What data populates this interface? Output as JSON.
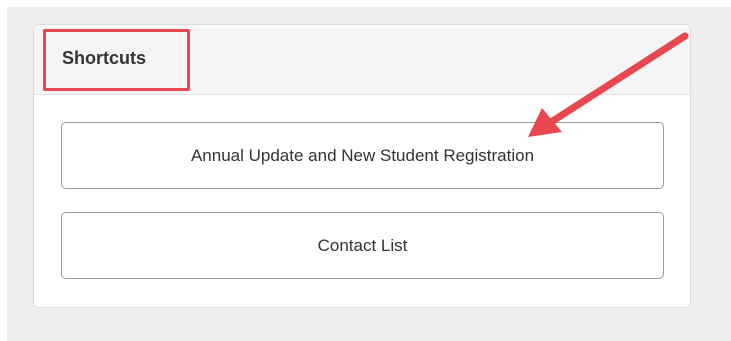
{
  "shortcuts": {
    "title": "Shortcuts",
    "buttons": [
      {
        "label": "Annual Update and New Student Registration"
      },
      {
        "label": "Contact List"
      }
    ]
  },
  "annotation": {
    "highlight_color": "#e8474f",
    "arrow_color": "#e8474f"
  }
}
